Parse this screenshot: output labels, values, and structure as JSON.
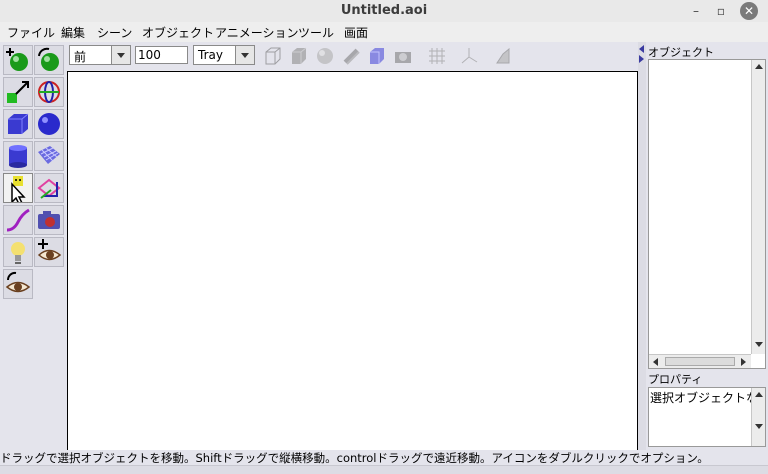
{
  "window": {
    "title": "Untitled.aoi"
  },
  "menubar": {
    "items": [
      "ファイル",
      "編集",
      "シーン",
      "オブジェクト",
      "アニメーション",
      "ツール",
      "画面"
    ]
  },
  "tools": [
    {
      "name": "move-tool",
      "icon": "move-icon"
    },
    {
      "name": "rotate-tool",
      "icon": "rotate-icon"
    },
    {
      "name": "scale-tool",
      "icon": "scale-icon"
    },
    {
      "name": "skew-tool",
      "icon": "skew-rotate-icon"
    },
    {
      "name": "cube-tool",
      "icon": "cube-icon"
    },
    {
      "name": "sphere-tool",
      "icon": "sphere-icon"
    },
    {
      "name": "cylinder-tool",
      "icon": "cylinder-icon"
    },
    {
      "name": "mesh-tool",
      "icon": "mesh-icon"
    },
    {
      "name": "polygon-tool",
      "icon": "polygon-icon"
    },
    {
      "name": "spline-tool",
      "icon": "spline-icon"
    },
    {
      "name": "curve-tool",
      "icon": "curve-icon"
    },
    {
      "name": "camera-tool",
      "icon": "camera-icon"
    },
    {
      "name": "light-tool",
      "icon": "lightbulb-icon"
    },
    {
      "name": "move-view-tool",
      "icon": "move-view-icon"
    },
    {
      "name": "rotate-view-tool",
      "icon": "rotate-view-icon"
    }
  ],
  "viewbar": {
    "view_direction": "前",
    "zoom": "100",
    "render_mode": "Tray",
    "icons": [
      "wireframe-icon",
      "shaded-cube-icon",
      "smooth-sphere-icon",
      "textured-icon",
      "transparent-icon",
      "render-camera-icon",
      "grid-icon",
      "axes-icon",
      "template-icon"
    ]
  },
  "object_panel": {
    "header": "オブジェクト"
  },
  "properties_panel": {
    "header": "プロパティ",
    "content": "選択オブジェクトなし"
  },
  "status": {
    "text": "ドラッグで選択オブジェクトを移動。Shiftドラッグで縦横移動。controlドラッグで遠近移動。アイコンをダブルクリックでオプション。"
  },
  "colors": {
    "background": "#e4e4ec",
    "viewport": "#ffffff",
    "accent": "#3a3aa0"
  }
}
